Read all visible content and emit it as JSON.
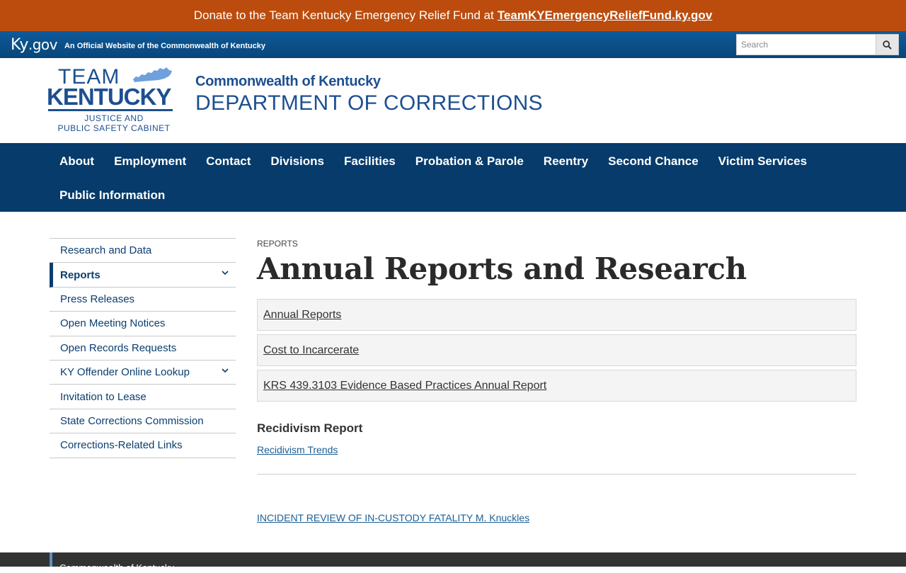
{
  "donate": {
    "text": "Donate to the Team Kentucky Emergency Relief Fund at",
    "link": "TeamKYEmergencyReliefFund.ky.gov"
  },
  "kygov": {
    "logo_main": "Ky",
    "logo_suffix": ".gov",
    "tagline": "An Official Website of the Commonwealth of Kentucky",
    "search_placeholder": "Search"
  },
  "header": {
    "logo_team": "TEAM",
    "logo_state": "KENTUCKY",
    "logo_sub1": "JUSTICE AND",
    "logo_sub2": "PUBLIC SAFETY CABINET",
    "agency_top": "Commonwealth of Kentucky",
    "agency_main": "DEPARTMENT OF CORRECTIONS"
  },
  "nav": [
    "About",
    "Employment",
    "Contact",
    "Divisions",
    "Facilities",
    "Probation & Parole",
    "Reentry",
    "Second Chance",
    "Victim Services",
    "Public Information"
  ],
  "sidebar": {
    "items": [
      {
        "label": "Research and Data"
      },
      {
        "label": "Reports"
      },
      {
        "label": "Press Releases"
      },
      {
        "label": "Open Meeting Notices"
      },
      {
        "label": "Open Records Requests"
      },
      {
        "label": "KY Offender Online Lookup"
      },
      {
        "label": "Invitation to Lease"
      },
      {
        "label": "State Corrections Commission"
      },
      {
        "label": "Corrections-Related Links"
      }
    ]
  },
  "main": {
    "breadcrumb": "REPORTS",
    "title": "Annual Reports and Research",
    "accordion": [
      "Annual Reports",
      "Cost to Incarcerate",
      "KRS 439.3103 Evidence Based Practices Annual Report"
    ],
    "recidivism_heading": "Recidivism Report",
    "recidivism_link": "Recidivism Trends",
    "incident_link": "INCIDENT REVIEW OF IN-CUSTODY FATALITY M. Knuckles"
  },
  "footer": {
    "text": "Commonwealth of Kentucky"
  },
  "colors": {
    "donate_bg": "#bc4c0d",
    "kygov_bg": "#084679",
    "nav_bg": "#063b6b",
    "brand_blue": "#1d4f91",
    "link": "#1b5f96"
  }
}
